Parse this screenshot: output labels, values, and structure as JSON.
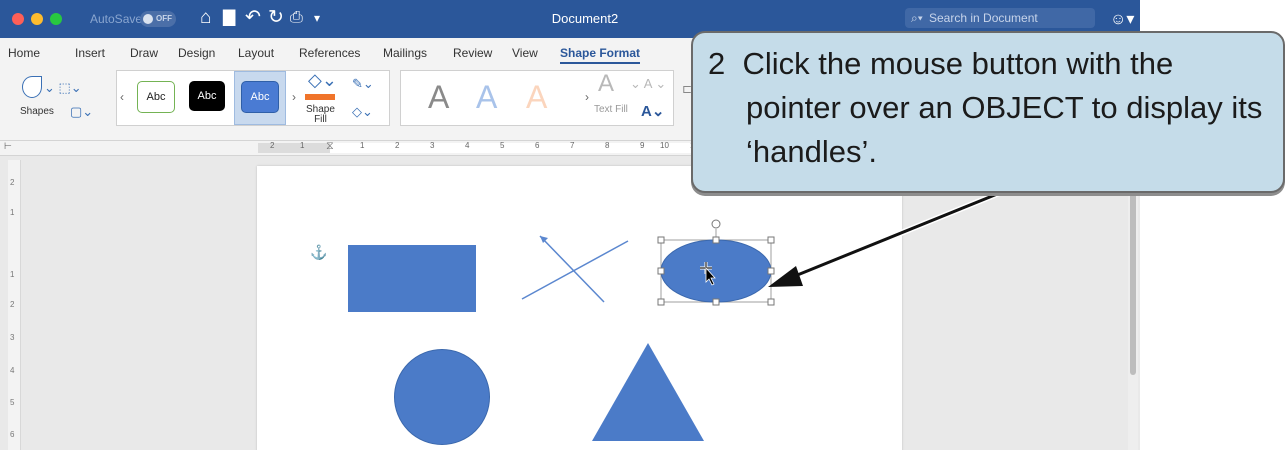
{
  "app": {
    "autosave_label": "AutoSave",
    "autosave_state": "OFF",
    "document_title": "Document2",
    "search_placeholder": "Search in Document"
  },
  "tabs": [
    {
      "label": "Home"
    },
    {
      "label": "Insert"
    },
    {
      "label": "Draw"
    },
    {
      "label": "Design"
    },
    {
      "label": "Layout"
    },
    {
      "label": "References"
    },
    {
      "label": "Mailings"
    },
    {
      "label": "Review"
    },
    {
      "label": "View"
    },
    {
      "label": "Shape Format",
      "active": true
    }
  ],
  "ribbon": {
    "shapes_label": "Shapes",
    "style_samples": [
      "Abc",
      "Abc",
      "Abc"
    ],
    "shape_fill_label": "Shape\nFill",
    "wordart_samples": [
      "A",
      "A",
      "A"
    ],
    "text_fill_label": "Text Fill"
  },
  "ruler": {
    "h_numbers": [
      "2",
      "1",
      "1",
      "2",
      "3",
      "4",
      "5",
      "6",
      "7",
      "8",
      "9",
      "10",
      "11"
    ],
    "v_numbers": [
      "2",
      "1",
      "1",
      "2",
      "3",
      "4",
      "5",
      "6"
    ]
  },
  "callout": {
    "line1": "2  Click the mouse button with the",
    "line2": "pointer over an OBJECT to display its",
    "line3": "‘handles’."
  },
  "colors": {
    "title_bar": "#2b579a",
    "shape_fill": "#4b7bc8",
    "callout_fill": "#c5dce9"
  },
  "icons": [
    "home-icon",
    "save-icon",
    "undo-icon",
    "redo-icon",
    "print-icon",
    "customize-icon",
    "search-icon",
    "smiley-icon",
    "anchor-icon",
    "rotate-handle-icon",
    "move-cursor-icon"
  ]
}
